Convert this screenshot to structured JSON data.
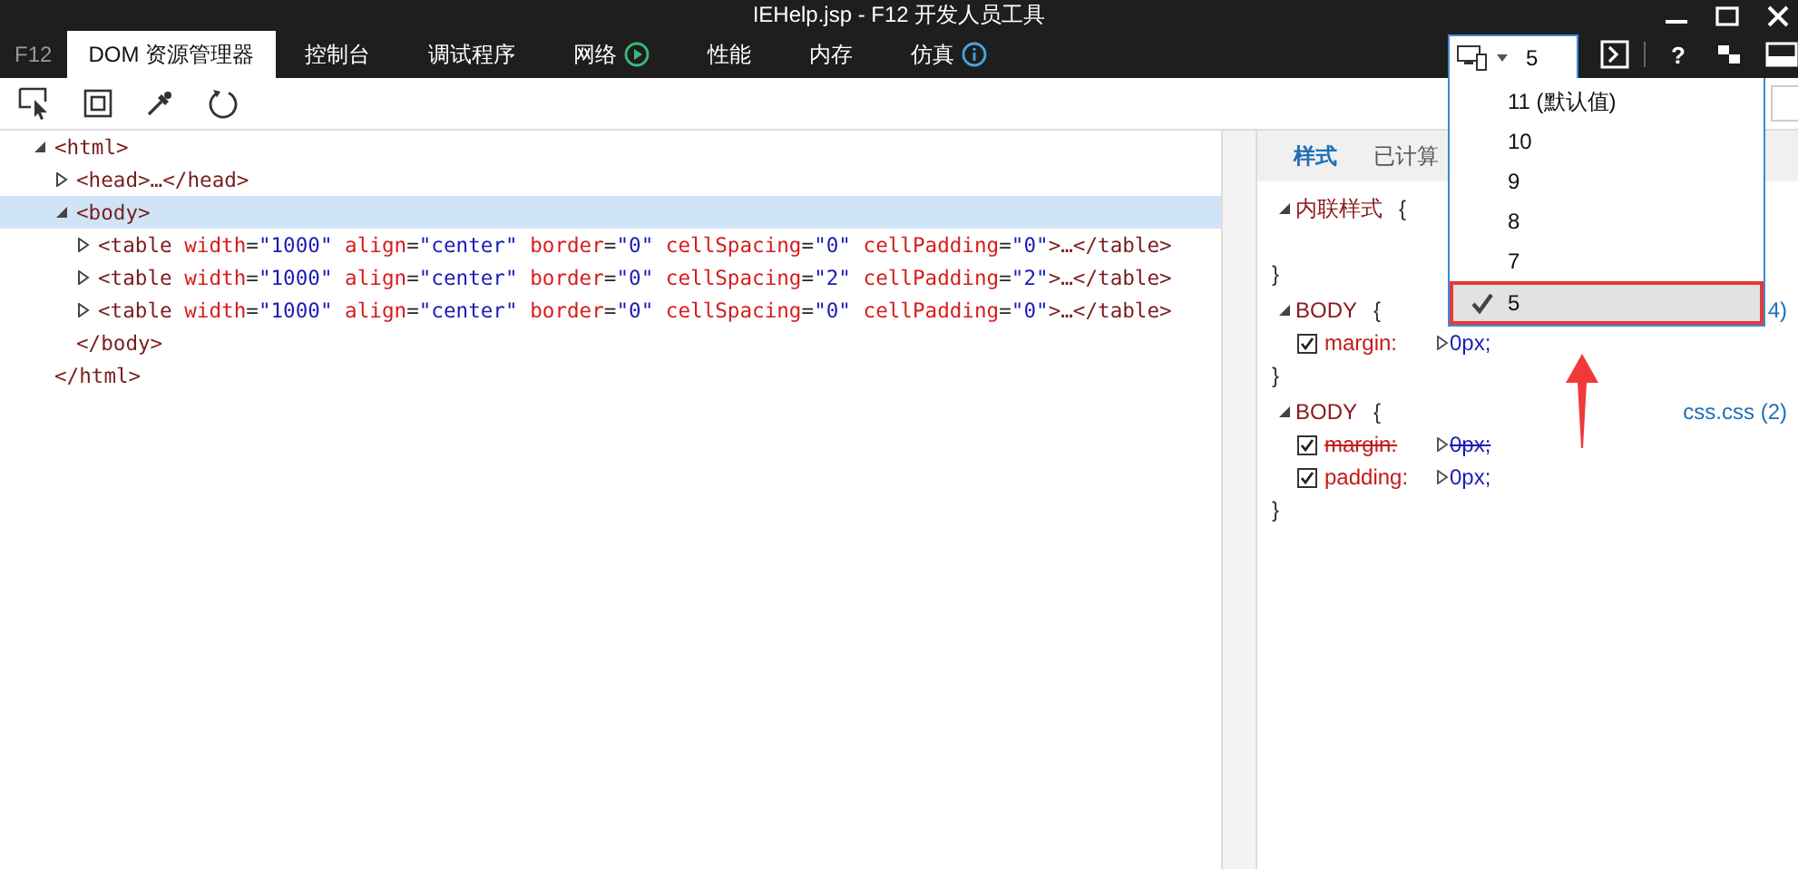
{
  "window": {
    "title": "IEHelp.jsp - F12 开发人员工具"
  },
  "app_label": "F12",
  "tabs": [
    {
      "label": "DOM 资源管理器",
      "selected": true
    },
    {
      "label": "控制台",
      "selected": false
    },
    {
      "label": "调试程序",
      "selected": false
    },
    {
      "label": "网络",
      "selected": false
    },
    {
      "label": "性能",
      "selected": false
    },
    {
      "label": "内存",
      "selected": false
    },
    {
      "label": "仿真",
      "selected": false
    }
  ],
  "document_mode": {
    "value": "5",
    "expanded": true,
    "options": [
      {
        "label": "11 (默认值)",
        "selected": false
      },
      {
        "label": "10",
        "selected": false
      },
      {
        "label": "9",
        "selected": false
      },
      {
        "label": "8",
        "selected": false
      },
      {
        "label": "7",
        "selected": false
      },
      {
        "label": "5",
        "selected": true
      }
    ]
  },
  "help_label": "?",
  "dom_tree": [
    {
      "tokens": [
        {
          "kind": "tag",
          "text": "<html>"
        }
      ],
      "expanded": true,
      "selected": false,
      "close": "</html>",
      "children": [
        {
          "tokens": [
            {
              "kind": "tag",
              "text": "<head>…</head>"
            }
          ],
          "expanded": false,
          "selected": false
        },
        {
          "tokens": [
            {
              "kind": "tag",
              "text": "<body>"
            }
          ],
          "expanded": true,
          "selected": true,
          "close": "</body>",
          "children": [
            {
              "tokens": [
                {
                  "kind": "tag",
                  "text": "<table"
                },
                {
                  "kind": "name",
                  "text": "width"
                },
                {
                  "kind": "punct",
                  "text": "="
                },
                {
                  "kind": "value",
                  "text": "\"1000\""
                },
                {
                  "kind": "name",
                  "text": "align"
                },
                {
                  "kind": "punct",
                  "text": "="
                },
                {
                  "kind": "value",
                  "text": "\"center\""
                },
                {
                  "kind": "name",
                  "text": "border"
                },
                {
                  "kind": "punct",
                  "text": "="
                },
                {
                  "kind": "value",
                  "text": "\"0\""
                },
                {
                  "kind": "name",
                  "text": "cellSpacing"
                },
                {
                  "kind": "punct",
                  "text": "="
                },
                {
                  "kind": "value",
                  "text": "\"0\""
                },
                {
                  "kind": "name",
                  "text": "cellPadding"
                },
                {
                  "kind": "punct",
                  "text": "="
                },
                {
                  "kind": "value",
                  "text": "\"0\""
                },
                {
                  "kind": "tag",
                  "text": ">…</table>"
                }
              ],
              "expanded": false,
              "selected": false
            },
            {
              "tokens": [
                {
                  "kind": "tag",
                  "text": "<table"
                },
                {
                  "kind": "name",
                  "text": "width"
                },
                {
                  "kind": "punct",
                  "text": "="
                },
                {
                  "kind": "value",
                  "text": "\"1000\""
                },
                {
                  "kind": "name",
                  "text": "align"
                },
                {
                  "kind": "punct",
                  "text": "="
                },
                {
                  "kind": "value",
                  "text": "\"center\""
                },
                {
                  "kind": "name",
                  "text": "border"
                },
                {
                  "kind": "punct",
                  "text": "="
                },
                {
                  "kind": "value",
                  "text": "\"0\""
                },
                {
                  "kind": "name",
                  "text": "cellSpacing"
                },
                {
                  "kind": "punct",
                  "text": "="
                },
                {
                  "kind": "value",
                  "text": "\"2\""
                },
                {
                  "kind": "name",
                  "text": "cellPadding"
                },
                {
                  "kind": "punct",
                  "text": "="
                },
                {
                  "kind": "value",
                  "text": "\"2\""
                },
                {
                  "kind": "tag",
                  "text": ">…</table>"
                }
              ],
              "expanded": false,
              "selected": false
            },
            {
              "tokens": [
                {
                  "kind": "tag",
                  "text": "<table"
                },
                {
                  "kind": "name",
                  "text": "width"
                },
                {
                  "kind": "punct",
                  "text": "="
                },
                {
                  "kind": "value",
                  "text": "\"1000\""
                },
                {
                  "kind": "name",
                  "text": "align"
                },
                {
                  "kind": "punct",
                  "text": "="
                },
                {
                  "kind": "value",
                  "text": "\"center\""
                },
                {
                  "kind": "name",
                  "text": "border"
                },
                {
                  "kind": "punct",
                  "text": "="
                },
                {
                  "kind": "value",
                  "text": "\"0\""
                },
                {
                  "kind": "name",
                  "text": "cellSpacing"
                },
                {
                  "kind": "punct",
                  "text": "="
                },
                {
                  "kind": "value",
                  "text": "\"0\""
                },
                {
                  "kind": "name",
                  "text": "cellPadding"
                },
                {
                  "kind": "punct",
                  "text": "="
                },
                {
                  "kind": "value",
                  "text": "\"0\""
                },
                {
                  "kind": "tag",
                  "text": ">…</table>"
                }
              ],
              "expanded": false,
              "selected": false
            }
          ]
        }
      ]
    }
  ],
  "styles_panel": {
    "tabs": [
      {
        "label": "样式",
        "selected": true
      },
      {
        "label": "已计算",
        "selected": false
      }
    ],
    "rules": [
      {
        "selector": "内联样式",
        "open": "{",
        "close": "}"
      },
      {
        "selector": "BODY",
        "open": "{",
        "close": "}",
        "source": "4)",
        "declarations": [
          {
            "checked": true,
            "property": "margin:",
            "value": "0px;",
            "overridden": false
          }
        ]
      },
      {
        "selector": "BODY",
        "open": "{",
        "close": "}",
        "source": "css.css (2)",
        "declarations": [
          {
            "checked": true,
            "property": "margin:",
            "value": "0px;",
            "overridden": true
          },
          {
            "checked": true,
            "property": "padding:",
            "value": "0px;",
            "overridden": false
          }
        ]
      }
    ]
  }
}
